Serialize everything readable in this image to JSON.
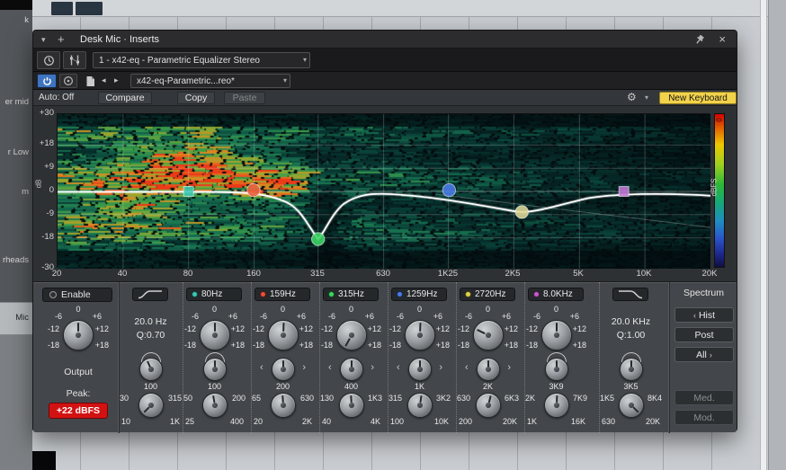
{
  "desktop": {
    "track_labels": [
      "k",
      "er mid",
      "r Low",
      "m",
      "rheads",
      "Mic"
    ]
  },
  "titlebar": {
    "title": "Desk Mic · Inserts"
  },
  "toolbar": {
    "plugin_selector": "1 - x42-eq - Parametric Equalizer Stereo",
    "preset_selector": "x42-eq-Parametric...reo*",
    "auto": "Auto: Off",
    "compare": "Compare",
    "copy": "Copy",
    "paste": "Paste",
    "new_keyboard": "New Keyboard"
  },
  "graph": {
    "db_ticks": [
      "+30",
      "+18",
      "+9",
      "0",
      "-9",
      "-18",
      "-30"
    ],
    "freq_ticks": [
      "20",
      "40",
      "80",
      "160",
      "315",
      "630",
      "1K25",
      "2K5",
      "5K",
      "10K",
      "20K"
    ],
    "axis_unit": "dB",
    "colorbar_top": "0",
    "colorbar_label": "dBFS",
    "points": [
      {
        "freq_hz": 80,
        "gain_db": 0,
        "shape": "square",
        "color": "#3cc8b4"
      },
      {
        "freq_hz": 159,
        "gain_db": 0.5,
        "shape": "circle",
        "color": "#e8603c"
      },
      {
        "freq_hz": 315,
        "gain_db": -18.5,
        "shape": "circle",
        "color": "#3cd664"
      },
      {
        "freq_hz": 1259,
        "gain_db": 0.5,
        "shape": "circle",
        "color": "#4a7ce8"
      },
      {
        "freq_hz": 2720,
        "gain_db": -8,
        "shape": "circle",
        "color": "#ded898"
      },
      {
        "freq_hz": 8000,
        "gain_db": 0,
        "shape": "square",
        "color": "#c478d8"
      }
    ]
  },
  "controls": {
    "enable": "Enable",
    "output": "Output",
    "peak_label": "Peak:",
    "peak_value": "+22 dBFS",
    "gain_scale": {
      "t": "0",
      "ul": "-6",
      "ur": "+6",
      "ml": "-12",
      "mr": "+12",
      "ll": "-18",
      "lr": "+18"
    },
    "hp": {
      "freq": "20.0 Hz",
      "q": "Q:0.70",
      "scale": {
        "t": "100",
        "l": "30",
        "r": "315",
        "bl": "10",
        "br": "1K"
      }
    },
    "lp": {
      "freq": "20.0 KHz",
      "q": "Q:1.00",
      "scale": {
        "t": "3K5",
        "l": "1K5",
        "r": "8K4",
        "bl": "630",
        "br": "20K"
      }
    },
    "bands": [
      {
        "label": "80Hz",
        "color": "#3cc8b4",
        "scale": {
          "t": "100",
          "l": "50",
          "r": "200",
          "bl": "25",
          "br": "400"
        }
      },
      {
        "label": "159Hz",
        "color": "#e8503c",
        "scale": {
          "t": "200",
          "l": "65",
          "r": "630",
          "bl": "20",
          "br": "2K"
        }
      },
      {
        "label": "315Hz",
        "color": "#3cd664",
        "scale": {
          "t": "400",
          "l": "130",
          "r": "1K3",
          "bl": "40",
          "br": "4K"
        }
      },
      {
        "label": "1259Hz",
        "color": "#4a7ce8",
        "scale": {
          "t": "1K",
          "l": "315",
          "r": "3K2",
          "bl": "100",
          "br": "10K"
        }
      },
      {
        "label": "2720Hz",
        "color": "#e0d44a",
        "scale": {
          "t": "2K",
          "l": "630",
          "r": "6K3",
          "bl": "200",
          "br": "20K"
        }
      },
      {
        "label": "8.0KHz",
        "color": "#c85ac8",
        "scale": {
          "t": "3K9",
          "l": "2K",
          "r": "7K9",
          "bl": "1K",
          "br": "16K"
        }
      }
    ],
    "spectrum": {
      "title": "Spectrum",
      "hist": "Hist",
      "post": "Post",
      "all": "All",
      "med": "Med.",
      "mod": "Mod."
    }
  }
}
